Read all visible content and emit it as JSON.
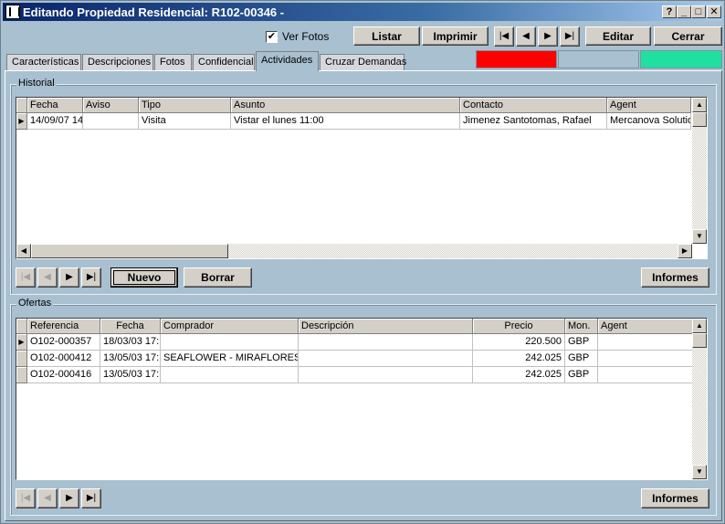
{
  "window": {
    "title": "Editando Propiedad Residencial: R102-00346 -",
    "controls": {
      "help": "?",
      "minimize": "_",
      "maximize": "□",
      "close": "✕"
    }
  },
  "toolbar": {
    "ver_fotos_label": "Ver Fotos",
    "ver_fotos_checked": true,
    "listar": "Listar",
    "imprimir": "Imprimir",
    "editar": "Editar",
    "cerrar": "Cerrar",
    "nav": {
      "first": "|◀",
      "prev": "◀",
      "next": "▶",
      "last": "▶|"
    }
  },
  "status_colors": [
    "#ff0000",
    "#a8c0d0",
    "#20e0a0"
  ],
  "tabs": [
    {
      "label": "Características"
    },
    {
      "label": "Descripciones"
    },
    {
      "label": "Fotos"
    },
    {
      "label": "Confidencial"
    },
    {
      "label": "Actividades",
      "active": true
    },
    {
      "label": "Cruzar Demandas"
    }
  ],
  "historial": {
    "title": "Historial",
    "columns": [
      "Fecha",
      "Aviso",
      "Tipo",
      "Asunto",
      "Contacto",
      "Agent"
    ],
    "rows": [
      [
        "14/09/07 14",
        "",
        "Visita",
        "Vistar el lunes 11:00",
        "Jimenez Santotomas, Rafael",
        "Mercanova Solutions"
      ]
    ],
    "buttons": {
      "nuevo": "Nuevo",
      "borrar": "Borrar",
      "informes": "Informes"
    }
  },
  "ofertas": {
    "title": "Ofertas",
    "columns": [
      "Referencia",
      "Fecha",
      "Comprador",
      "Descripción",
      "Precio",
      "Mon.",
      "Agent"
    ],
    "rows": [
      [
        "O102-000357",
        "18/03/03 17:",
        "",
        "",
        "220.500",
        "GBP",
        ""
      ],
      [
        "O102-000412",
        "13/05/03 17:",
        "SEAFLOWER - MIRAFLORES,",
        "",
        "242.025",
        "GBP",
        ""
      ],
      [
        "O102-000416",
        "13/05/03 17:",
        "",
        "",
        "242.025",
        "GBP",
        ""
      ]
    ],
    "buttons": {
      "informes": "Informes"
    }
  },
  "icons": {
    "row_pointer": "▶",
    "scroll_up": "▲",
    "scroll_down": "▼",
    "scroll_left": "◀",
    "scroll_right": "▶",
    "check": "✔"
  }
}
